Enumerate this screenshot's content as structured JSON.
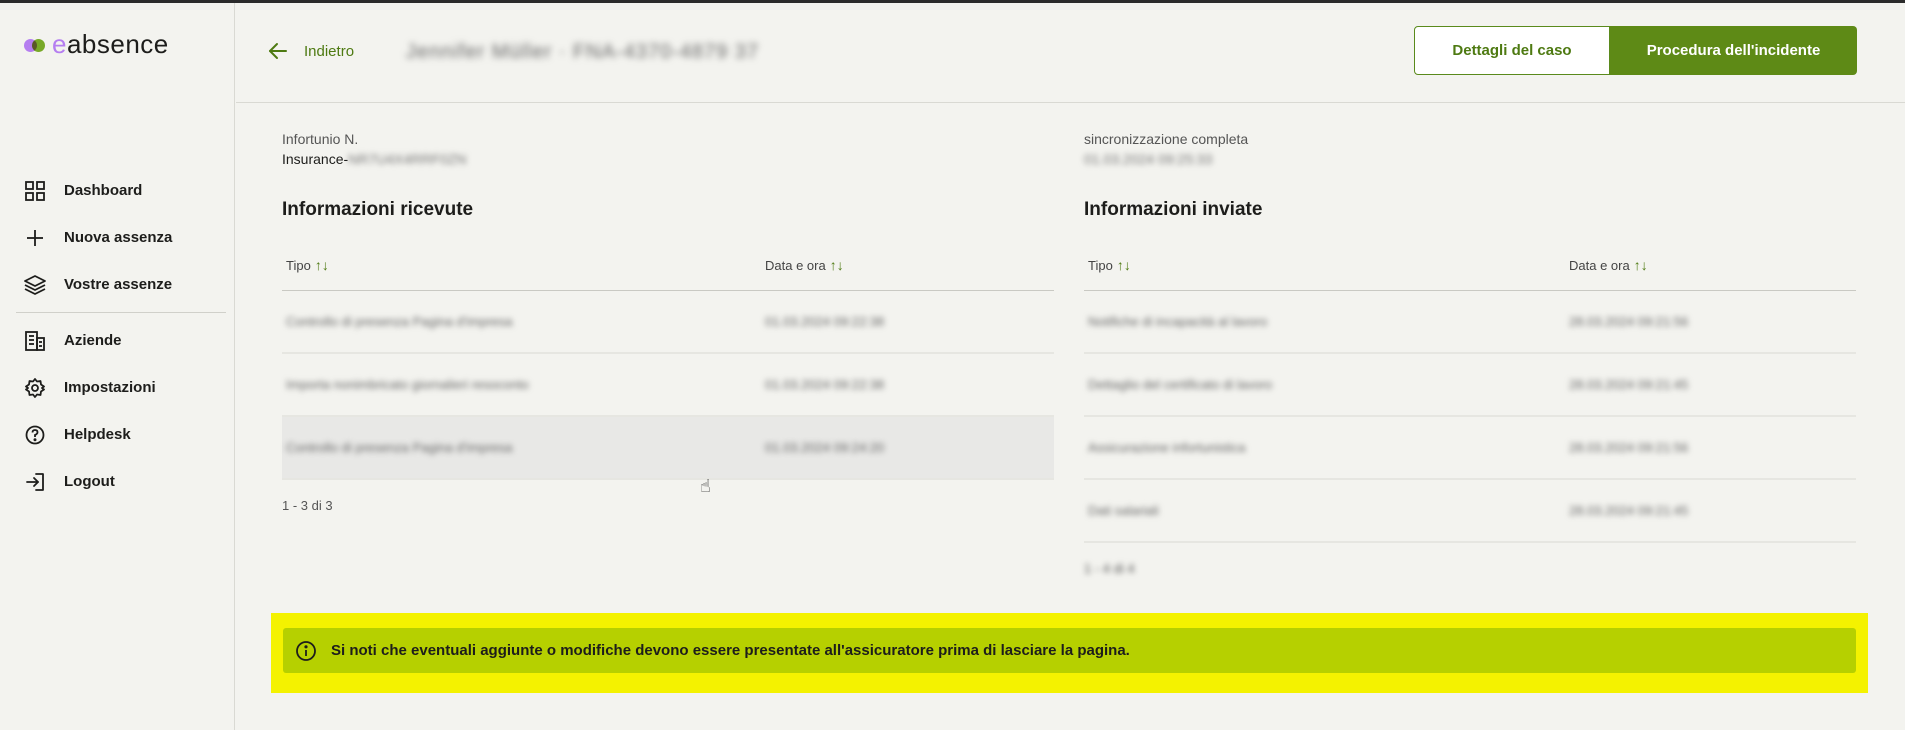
{
  "brand": {
    "prefix": "e",
    "name": "absence"
  },
  "sidebar": {
    "items": [
      {
        "label": "Dashboard",
        "icon": "grid-icon"
      },
      {
        "label": "Nuova assenza",
        "icon": "plus-icon"
      },
      {
        "label": "Vostre assenze",
        "icon": "layers-icon"
      }
    ],
    "items2": [
      {
        "label": "Aziende",
        "icon": "building-icon"
      },
      {
        "label": "Impostazioni",
        "icon": "gear-icon"
      },
      {
        "label": "Helpdesk",
        "icon": "help-icon"
      },
      {
        "label": "Logout",
        "icon": "logout-icon"
      }
    ]
  },
  "header": {
    "back_label": "Indietro",
    "case_title": "Jennifer Müller · FNA-4370-4879 37",
    "btn_details": "Dettagli del caso",
    "btn_procedure": "Procedura dell'incidente"
  },
  "left": {
    "meta_label": "Infortunio N.",
    "meta_prefix": "Insurance-",
    "meta_blur": "NR7U4X4RRF0ZN",
    "title": "Informazioni ricevute",
    "col_type": "Tipo",
    "col_date": "Data e ora",
    "rows": [
      {
        "type": "Controllo di presenza Pagina d'impresa",
        "date": "01.03.2024 09:22:38"
      },
      {
        "type": "Importa nonimbricato giornalieri resoconto",
        "date": "01.03.2024 09:22:38"
      },
      {
        "type": "Controllo di presenza Pagina d'impresa",
        "date": "01.03.2024 09:24:20"
      }
    ],
    "pager": "1 - 3 di 3"
  },
  "right": {
    "meta_label": "sincronizzazione completa",
    "meta_blur": "01.03.2024 09:25:33",
    "title": "Informazioni inviate",
    "col_type": "Tipo",
    "col_date": "Data e ora",
    "rows": [
      {
        "type": "Notifiche di incapacità al lavoro",
        "date": "28.03.2024 09:21:56"
      },
      {
        "type": "Dettaglio del certificato di lavoro",
        "date": "28.03.2024 09:21:45"
      },
      {
        "type": "Assicurazione infortunistica",
        "date": "28.03.2024 09:21:56"
      },
      {
        "type": "Dati salariali",
        "date": "28.03.2024 09:21:45"
      }
    ],
    "pager": "1 - 4 di 4"
  },
  "notice": {
    "text": "Si noti che eventuali aggiunte o modifiche devono essere presentate all'assicuratore prima di lasciare la pagina."
  },
  "colors": {
    "accent": "#5e8a16",
    "notice_outer": "#f4f200",
    "notice_inner": "#b6d000"
  }
}
